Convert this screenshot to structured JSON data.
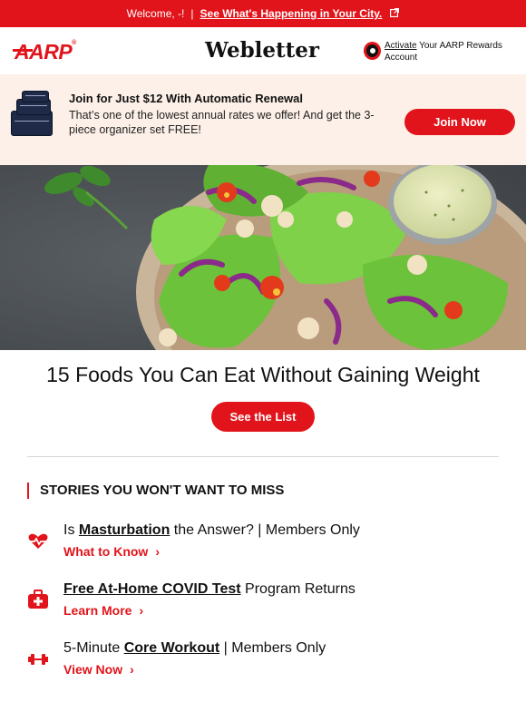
{
  "topbar": {
    "welcome": "Welcome, -!",
    "separator": "|",
    "link": "See What's Happening in Your City."
  },
  "header": {
    "logo": "AARP",
    "title": "Webletter",
    "rewards": {
      "activate": "Activate",
      "rest": " Your AARP Rewards Account"
    }
  },
  "promo": {
    "title": "Join for Just $12 With Automatic Renewal",
    "description": "That’s one of the lowest annual rates we offer! And get the 3-piece organizer set FREE!",
    "button": "Join Now"
  },
  "hero": {
    "headline": "15 Foods You Can Eat Without Gaining Weight",
    "cta": "See the List"
  },
  "section": {
    "title": "STORIES YOU WON'T WANT TO MISS"
  },
  "stories": [
    {
      "pre": "Is ",
      "bold": "Masturbation",
      "post": " the Answer? | Members Only",
      "link": "What to Know",
      "icon": "heart-pulse-icon"
    },
    {
      "pre": "",
      "bold": "Free At-Home COVID Test",
      "post": " Program Returns",
      "link": "Learn More",
      "icon": "medical-kit-icon"
    },
    {
      "pre": "5-Minute ",
      "bold": "Core Workout",
      "post": " | Members Only",
      "link": "View Now",
      "icon": "dumbbell-icon"
    }
  ],
  "colors": {
    "brand_red": "#e2141b",
    "promo_bg": "#fdf0e8"
  }
}
